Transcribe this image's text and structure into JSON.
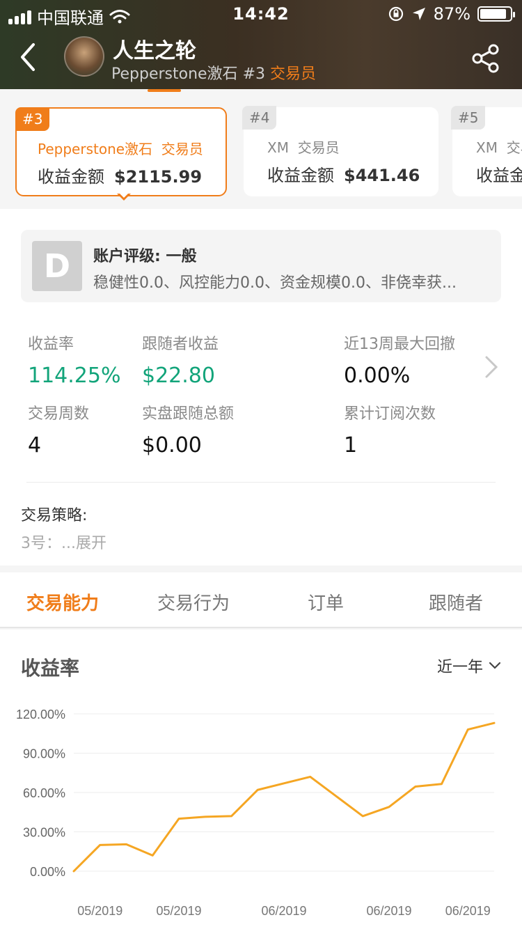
{
  "status_bar": {
    "carrier": "中国联通",
    "time": "14:42",
    "battery": "87%",
    "battery_level": 0.87
  },
  "header": {
    "name": "人生之轮",
    "broker": "Pepperstone激石",
    "rank": "#3",
    "role": "交易员"
  },
  "rank_cards": [
    {
      "badge": "#3",
      "broker": "Pepperstone激石",
      "role": "交易员",
      "earn_label": "收益金额",
      "earn_value": "$2115.99"
    },
    {
      "badge": "#4",
      "broker": "XM",
      "role": "交易员",
      "earn_label": "收益金额",
      "earn_value": "$441.46"
    },
    {
      "badge": "#5",
      "broker": "XM",
      "role": "交易员",
      "earn_label": "收益金额",
      "earn_value": ""
    }
  ],
  "rating": {
    "grade": "D",
    "title": "账户评级: 一般",
    "desc": "稳健性0.0、风控能力0.0、资金规模0.0、非侥幸获..."
  },
  "stats": {
    "return_rate": {
      "label": "收益率",
      "value": "114.25%"
    },
    "follower_profit": {
      "label": "跟随者收益",
      "value": "$22.80"
    },
    "max_drawdown": {
      "label": "近13周最大回撤",
      "value": "0.00%"
    },
    "trade_weeks": {
      "label": "交易周数",
      "value": "4"
    },
    "real_follow_total": {
      "label": "实盘跟随总额",
      "value": "$0.00"
    },
    "subscriptions": {
      "label": "累计订阅次数",
      "value": "1"
    }
  },
  "strategy": {
    "label": "交易策略:",
    "text": "3号：...展开"
  },
  "tabs": [
    "交易能力",
    "交易行为",
    "订单",
    "跟随者"
  ],
  "chart_section": {
    "title": "收益率",
    "range": "近一年"
  },
  "chart_data": {
    "type": "line",
    "title": "收益率",
    "y_tick_labels": [
      "0.00%",
      "30.00%",
      "60.00%",
      "90.00%",
      "120.00%"
    ],
    "y_ticks": [
      0,
      30,
      60,
      90,
      120
    ],
    "ylim": [
      0,
      120
    ],
    "x_tick_labels": [
      "05/2019",
      "05/2019",
      "06/2019",
      "06/2019",
      "06/2019"
    ],
    "x_tick_positions": [
      1,
      4,
      8,
      12,
      15
    ],
    "x": [
      0,
      1,
      2,
      3,
      4,
      5,
      6,
      7,
      8,
      9,
      10,
      11,
      12,
      13,
      14,
      15,
      16
    ],
    "series": [
      {
        "values": [
          0,
          20,
          20.5,
          12,
          40,
          41.5,
          42,
          62,
          67,
          72,
          57,
          42,
          49,
          64.5,
          66.5,
          108,
          113
        ]
      }
    ],
    "color": "#f5a623",
    "grid": true
  }
}
